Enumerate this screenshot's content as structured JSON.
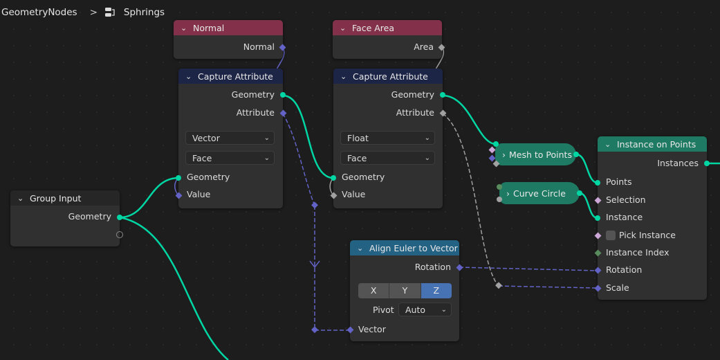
{
  "breadcrumb": {
    "root": "GeometryNodes",
    "separator": ">",
    "tree_icon": "node-tree-icon",
    "tree_name": "Sphrings"
  },
  "colors": {
    "geometry": "#00d6a3",
    "vector": "#6363c7",
    "float": "#a1a1a1",
    "boolean": "#cca6d6",
    "integer": "#598c5c",
    "input_header": "#83314a",
    "attribute_header": "#1d2546",
    "geometry_header": "#1e7a63",
    "converter_header": "#246283"
  },
  "nodes": {
    "normal": {
      "title": "Normal",
      "outputs": [
        "Normal"
      ]
    },
    "face_area": {
      "title": "Face Area",
      "outputs": [
        "Area"
      ]
    },
    "capture1": {
      "title": "Capture Attribute",
      "outputs": [
        "Geometry",
        "Attribute"
      ],
      "data_type": "Vector",
      "domain": "Face",
      "inputs": [
        "Geometry",
        "Value"
      ]
    },
    "capture2": {
      "title": "Capture Attribute",
      "outputs": [
        "Geometry",
        "Attribute"
      ],
      "data_type": "Float",
      "domain": "Face",
      "inputs": [
        "Geometry",
        "Value"
      ]
    },
    "group_input": {
      "title": "Group Input",
      "outputs": [
        "Geometry"
      ]
    },
    "mesh_to_points": {
      "title": "Mesh to Points"
    },
    "curve_circle": {
      "title": "Curve Circle"
    },
    "instance_on_points": {
      "title": "Instance on Points",
      "outputs": [
        "Instances"
      ],
      "inputs": [
        "Points",
        "Selection",
        "Instance",
        "Pick Instance",
        "Instance Index",
        "Rotation",
        "Scale"
      ]
    },
    "align_euler": {
      "title": "Align Euler to Vector",
      "outputs": [
        "Rotation"
      ],
      "axis_options": [
        "X",
        "Y",
        "Z"
      ],
      "axis_selected": "Z",
      "pivot_label": "Pivot",
      "pivot_value": "Auto",
      "inputs": [
        "Vector"
      ]
    }
  }
}
